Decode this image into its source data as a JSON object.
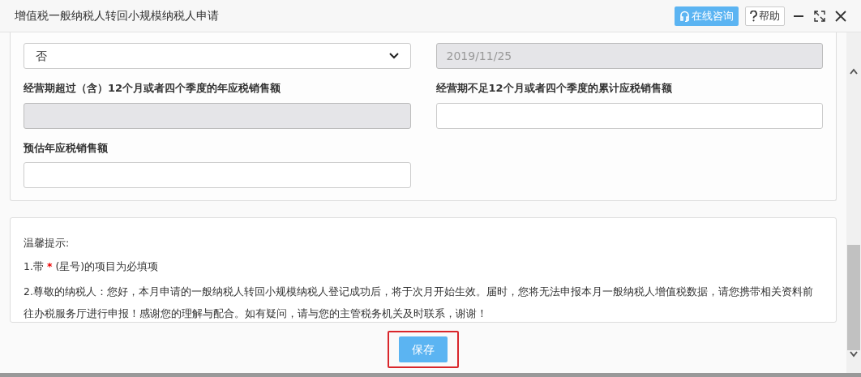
{
  "window": {
    "title": "增值税一般纳税人转回小规模纳税人申请",
    "buttons": [
      {
        "kind": "chat",
        "label": "在线咨询"
      },
      {
        "kind": "help",
        "label": "帮助"
      }
    ]
  },
  "fields": [
    {
      "kind": "select",
      "value": "否"
    },
    {
      "kind": "input",
      "value": "2019/11/25",
      "disabled": true
    },
    {
      "kind": "input",
      "label": "经营期超过（含）12个月或者四个季度的年应税销售额",
      "disabled": true
    },
    {
      "kind": "input",
      "label": "经营期不足12个月或者四个季度的累计应税销售额",
      "disabled": false
    },
    {
      "kind": "input",
      "label": "预估年应税销售额",
      "disabled": false
    }
  ],
  "tips": {
    "heading": "温馨提示:",
    "required_note": {
      "before": "1.带",
      "mark": "*",
      "after": "(星号)的项目为必填项"
    },
    "notice": "2.尊敬的纳税人：您好，本月申请的一般纳税人转回小规模纳税人登记成功后，将于次月开始生效。届时，您将无法申报本月一般纳税人增值税数据，请您携带相关资料前往办税服务厅进行申报！感谢您的理解与配合。如有疑问，请与您的主管税务机关及时联系，谢谢！"
  },
  "save_button": {
    "label": "保存",
    "highlighted": true
  }
}
